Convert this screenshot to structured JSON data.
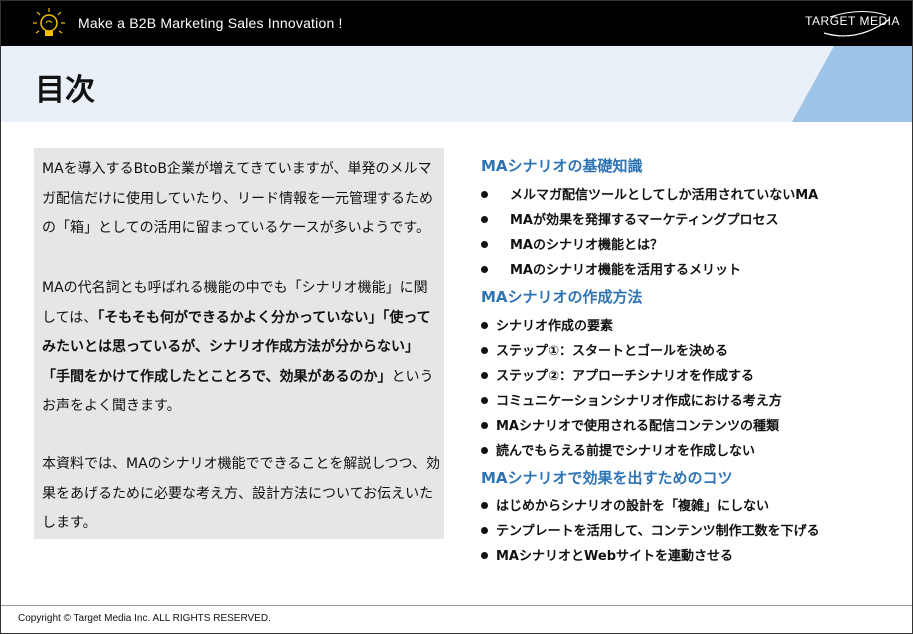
{
  "header": {
    "banner_text": "Make a B2B Marketing Sales Innovation !",
    "brand": "TARGET MEDIA"
  },
  "title": "目次",
  "intro": {
    "p1": "MAを導入するBtoB企業が増えてきていますが、単発のメルマガ配信だけに使用していたり、リード情報を一元管理するための「箱」としての活用に留まっているケースが多いようです。",
    "p2_a": "MAの代名詞とも呼ばれる機能の中でも「シナリオ機能」に関しては、",
    "p2_bold": "「そもそも何ができるかよく分かっていない」「使ってみたいとは思っているが、シナリオ作成方法が分からない」「手間をかけて作成したとことろで、効果があるのか」",
    "p2_c": "というお声をよく聞きます。",
    "p3": "本資料では、MAのシナリオ機能でできることを解説しつつ、効果をあげるために必要な考え方、設計方法についてお伝えいたします。"
  },
  "toc": {
    "sections": [
      {
        "title": "MAシナリオの基礎知識",
        "items": [
          "メルマガ配信ツールとしてしか活用されていないMA",
          "MAが効果を発揮するマーケティングプロセス",
          "MAのシナリオ機能とは？",
          "MAのシナリオ機能を活用するメリット"
        ]
      },
      {
        "title": "MAシナリオの作成方法",
        "items": [
          "シナリオ作成の要素",
          "ステップ①：スタートとゴールを決める",
          "ステップ②：アプローチシナリオを作成する",
          "コミュニケーションシナリオ作成における考え方",
          "MAシナリオで使用される配信コンテンツの種類",
          "読んでもらえる前提でシナリオを作成しない"
        ]
      },
      {
        "title": "MAシナリオで効果を出すためのコツ",
        "items": [
          "はじめからシナリオの設計を「複雑」にしない",
          "テンプレートを活用して、コンテンツ制作工数を下げる",
          "MAシナリオとWebサイトを連動させる"
        ]
      }
    ]
  },
  "footer": "Copyright © Target Media Inc. ALL RIGHTS RESERVED.",
  "colors": {
    "banner": "#000000",
    "title_band": "#eaf0f8",
    "accent_blue": "#9dc3e6",
    "section_title": "#2e74b5",
    "intro_box": "#e6e6e6"
  },
  "icons": [
    "lightbulb-icon",
    "bullet-dot-icon"
  ]
}
